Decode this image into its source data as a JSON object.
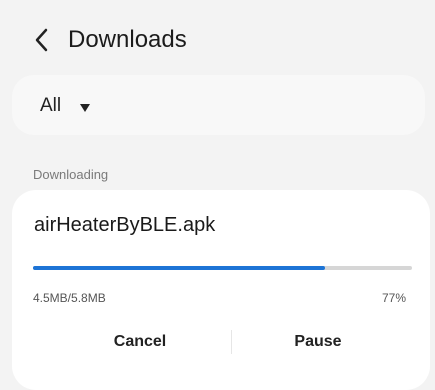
{
  "header": {
    "title": "Downloads",
    "back_icon": "chevron-left-icon"
  },
  "filter": {
    "selected": "All",
    "dropdown_icon": "caret-down-icon"
  },
  "section": {
    "label": "Downloading"
  },
  "download": {
    "file_name": "airHeaterByBLE.apk",
    "size_progress": "4.5MB/5.8MB",
    "percent_label": "77%",
    "progress_fraction": 0.77,
    "cancel_label": "Cancel",
    "pause_label": "Pause"
  },
  "colors": {
    "accent": "#1d74d6",
    "track": "#d6d6d6",
    "background": "#f3f3f3",
    "card": "#ffffff"
  }
}
